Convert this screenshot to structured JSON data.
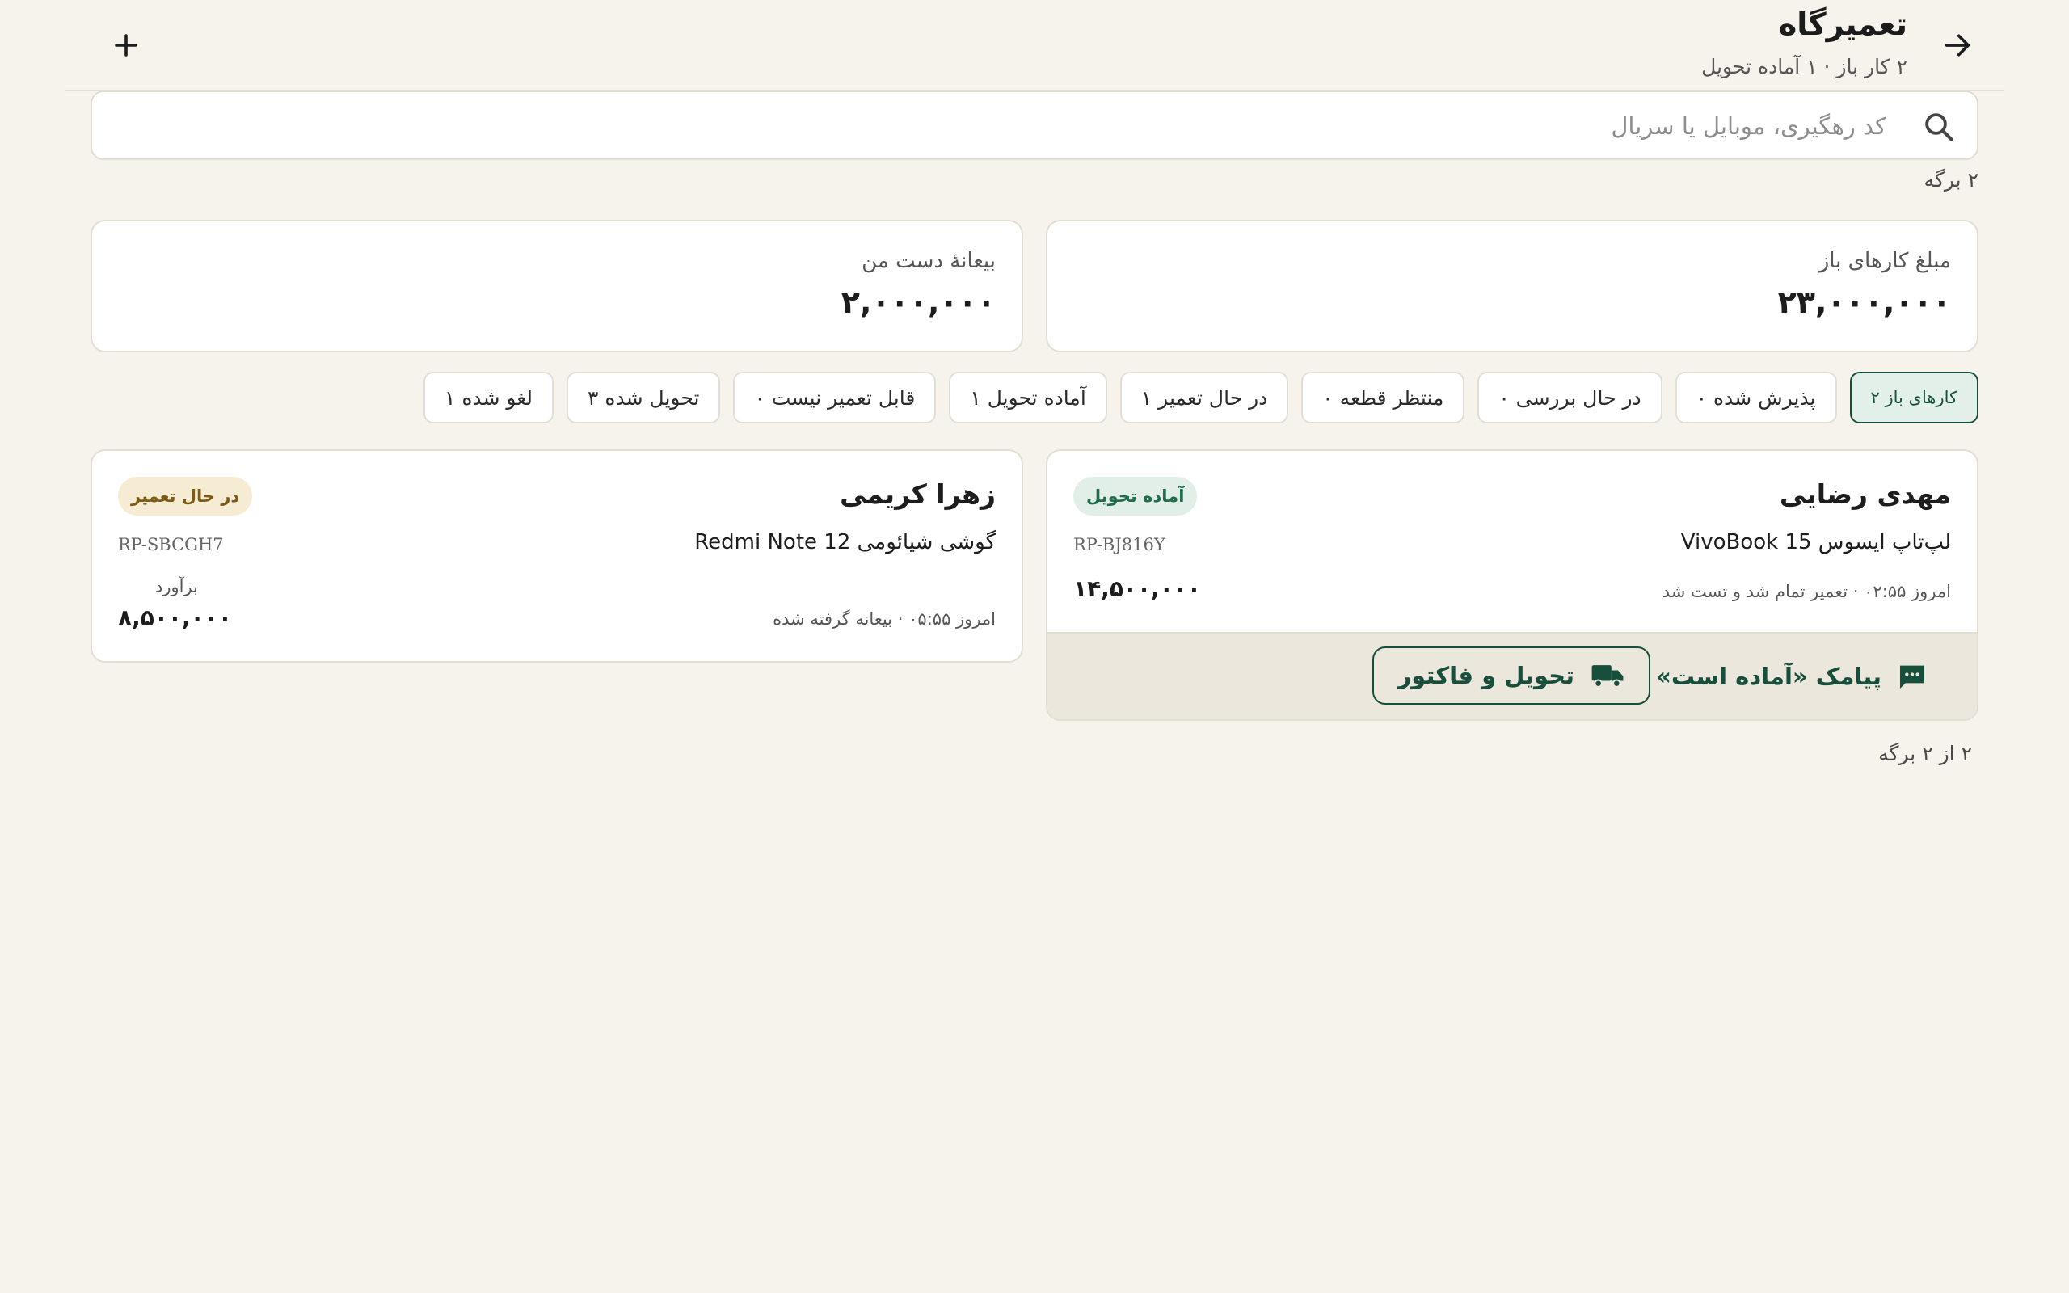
{
  "header": {
    "title": "تعمیرگاه",
    "subtitle": "۲ کار باز · ۱ آماده تحویل",
    "back_icon": "arrow-right-icon",
    "add_icon": "plus-icon"
  },
  "search": {
    "placeholder": "کد رهگیری، موبایل یا سریال",
    "value": ""
  },
  "results_count": "۲ برگه",
  "stats": [
    {
      "label": "مبلغ کارهای باز",
      "value": "۲۳,۰۰۰,۰۰۰"
    },
    {
      "label": "بیعانهٔ دست من",
      "value": "۲,۰۰۰,۰۰۰"
    }
  ],
  "chips": [
    {
      "label": "کارهای باز ۲",
      "active": true
    },
    {
      "label": "پذیرش شده ۰"
    },
    {
      "label": "در حال بررسی ۰"
    },
    {
      "label": "منتظر قطعه ۰"
    },
    {
      "label": "در حال تعمیر ۱"
    },
    {
      "label": "آماده تحویل ۱"
    },
    {
      "label": "قابل تعمیر نیست ۰"
    },
    {
      "label": "تحویل شده ۳"
    },
    {
      "label": "لغو شده ۱"
    }
  ],
  "jobs": [
    {
      "customer": "مهدی رضایی",
      "status": "آماده تحویل",
      "device": "لپ‌تاپ ایسوس VivoBook 15",
      "code": "RP-BJ816Y",
      "meta": "امروز ۰۲:۵۵ · تعمیر تمام شد و تست شد",
      "price": "۱۴,۵۰۰,۰۰۰",
      "actions": {
        "sms_label": "پیامک «آماده است»",
        "deliver_label": "تحویل و فاکتور"
      }
    },
    {
      "customer": "زهرا کریمی",
      "status": "در حال تعمیر",
      "device": "گوشی شیائومی Redmi Note 12",
      "code": "RP-SBCGH7",
      "meta": "امروز ۰۵:۵۵ · بیعانه گرفته شده",
      "estimate_label": "برآورد",
      "price": "۸,۵۰۰,۰۰۰"
    }
  ],
  "pager": "۲ از ۲ برگه",
  "colors": {
    "background": "#f6f3ec",
    "accent": "#174f3c",
    "ready_badge": "#e2efe8",
    "repair_badge": "#f6ebd3"
  }
}
